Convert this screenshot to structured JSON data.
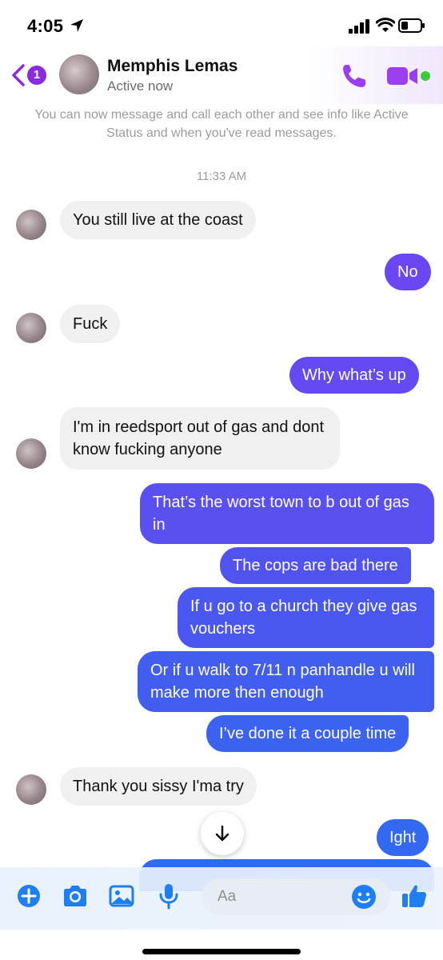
{
  "status_bar": {
    "time": "4:05"
  },
  "header": {
    "back_badge_count": "1",
    "contact_name": "Memphis Lemas",
    "status": "Active now"
  },
  "info": {
    "text": "You can now message and call each other and see info like Active Status and when you've read messages."
  },
  "timestamp": "11:33 AM",
  "messages": [
    {
      "direction": "in",
      "text": "You still live at the coast"
    },
    {
      "direction": "out",
      "text": "No"
    },
    {
      "direction": "in",
      "text": "Fuck"
    },
    {
      "direction": "out",
      "text": "Why what’s up"
    },
    {
      "direction": "in",
      "text": "I'm in reedsport out of gas and dont know fucking anyone"
    },
    {
      "direction": "out",
      "text": "That’s the worst town to b out of gas in"
    },
    {
      "direction": "out",
      "text": "The cops are bad there"
    },
    {
      "direction": "out",
      "text": "If u go to a church they give gas vouchers"
    },
    {
      "direction": "out",
      "text": "Or if u walk to 7/11 n panhandle u will make more then enough"
    },
    {
      "direction": "out",
      "text": "I’ve done it a couple time"
    },
    {
      "direction": "in",
      "text": "Thank you sissy I'ma try"
    },
    {
      "direction": "out",
      "text": "Ight"
    }
  ],
  "composer": {
    "placeholder": "Aa"
  },
  "colors": {
    "messenger_purple": "#8a2be2",
    "outgoing_top": "#7d3cf3",
    "outgoing_bottom": "#2f6bf0",
    "incoming_bubble": "#f0f0f0",
    "icon_blue": "#1f7ff2"
  }
}
